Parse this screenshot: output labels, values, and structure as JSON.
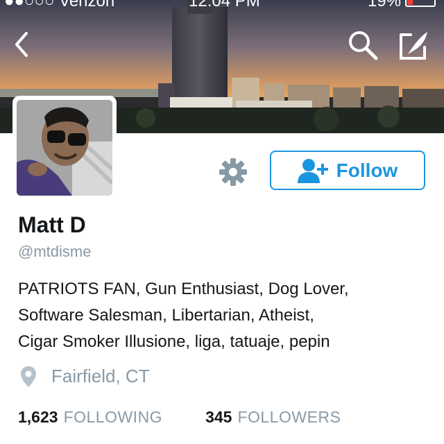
{
  "status_bar": {
    "carrier": "●●○○○ Verizon",
    "time": "12:04 PM",
    "battery": "19%"
  },
  "nav": {
    "back_icon": "chevron-left-icon",
    "search_icon": "search-icon",
    "compose_icon": "compose-tweet-icon"
  },
  "profile": {
    "name": "Matt D",
    "handle": "@mtdisme",
    "bio": [
      "PATRIOTS FAN, Gun Enthusiast, Dog Lover,",
      "Software Salesman, Libertarian, Atheist,",
      "Cigar Smoker Illusione, liga, tatuaje, pepin"
    ],
    "location": "Fairfield, CT",
    "following_count": "1,623",
    "following_label": "FOLLOWING",
    "followers_count": "345",
    "followers_label": "FOLLOWERS"
  },
  "actions": {
    "follow_label": "Follow",
    "settings_icon": "gear-icon"
  },
  "colors": {
    "accent": "#1b95e0",
    "secondary_text": "#8899a6",
    "primary_text": "#14171a"
  }
}
